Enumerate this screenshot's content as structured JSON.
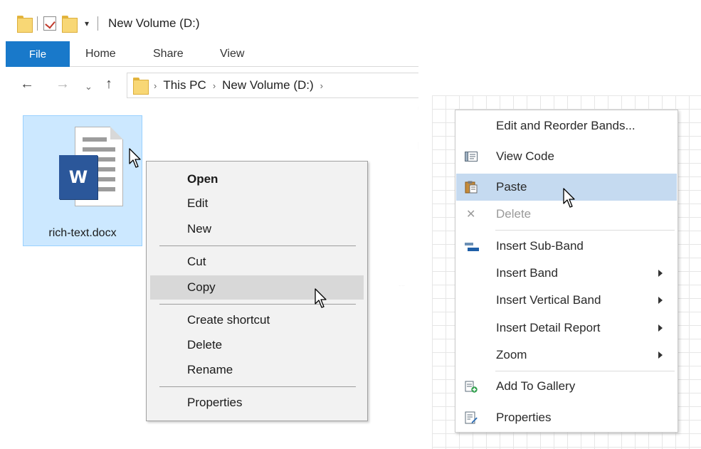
{
  "explorer": {
    "window_title": "New Volume (D:)",
    "qat_dropdown_glyph": "▾",
    "ribbon_tabs": [
      "File",
      "Home",
      "Share",
      "View"
    ],
    "nav": {
      "back": "←",
      "forward": "→",
      "recent": "⌄",
      "up": "↑"
    },
    "breadcrumb": [
      "This PC",
      "New Volume (D:)"
    ],
    "breadcrumb_sep": "›",
    "file": {
      "name": "rich-text.docx",
      "badge": "W"
    }
  },
  "file_context_menu": {
    "open": "Open",
    "edit": "Edit",
    "new": "New",
    "cut": "Cut",
    "copy": "Copy",
    "create_shortcut": "Create shortcut",
    "delete": "Delete",
    "rename": "Rename",
    "properties": "Properties",
    "highlighted_item": "Copy"
  },
  "report_context_menu": {
    "edit_reorder": "Edit and Reorder Bands...",
    "view_code": "View Code",
    "paste": "Paste",
    "delete": "Delete",
    "insert_sub_band": "Insert Sub-Band",
    "insert_band": "Insert Band",
    "insert_vertical_band": "Insert Vertical Band",
    "insert_detail_report": "Insert Detail Report",
    "zoom": "Zoom",
    "add_to_gallery": "Add To Gallery",
    "properties": "Properties",
    "highlighted_item": "Paste",
    "disabled_item": "Delete",
    "delete_glyph": "✕"
  },
  "colors": {
    "file_tab": "#1979ca",
    "selection": "#cce8ff",
    "word_blue": "#2b579a",
    "menu1_highlight": "#d8d8d8",
    "menu2_highlight": "#c5daf0"
  }
}
